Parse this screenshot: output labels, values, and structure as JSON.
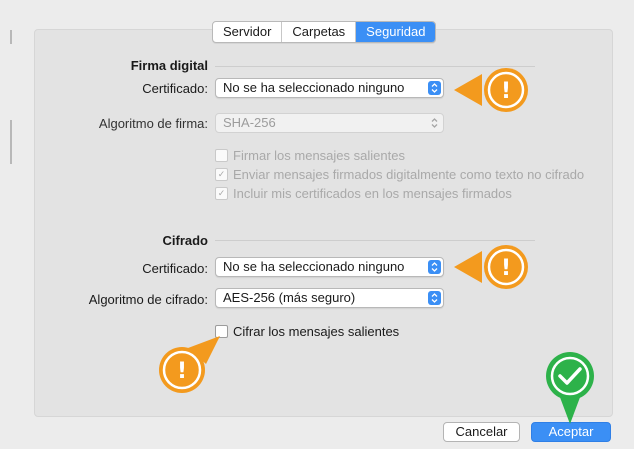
{
  "tabs": [
    {
      "label": "Servidor",
      "active": false
    },
    {
      "label": "Carpetas",
      "active": false
    },
    {
      "label": "Seguridad",
      "active": true
    }
  ],
  "firma": {
    "title": "Firma digital",
    "cert_label": "Certificado:",
    "cert_value": "No se ha seleccionado ninguno",
    "alg_label": "Algoritmo de firma:",
    "alg_value": "SHA-256",
    "checks": [
      {
        "label": "Firmar los mensajes salientes",
        "checked": false
      },
      {
        "label": "Enviar mensajes firmados digitalmente como texto no cifrado",
        "checked": true
      },
      {
        "label": "Incluir mis certificados en los mensajes firmados",
        "checked": true
      }
    ]
  },
  "cifrado": {
    "title": "Cifrado",
    "cert_label": "Certificado:",
    "cert_value": "No se ha seleccionado ninguno",
    "alg_label": "Algoritmo de cifrado:",
    "alg_value": "AES-256 (más seguro)",
    "check": {
      "label": "Cifrar los mensajes salientes",
      "checked": false
    }
  },
  "buttons": {
    "cancel": "Cancelar",
    "ok": "Aceptar"
  },
  "glyphs": {
    "warning": "!",
    "check": "✓",
    "stepper": "⌃⌄"
  },
  "colors": {
    "accent": "#3b8ff5",
    "warning": "#f39a1e",
    "success": "#2db24a"
  },
  "icons": {
    "warning_callout": "exclamation-warning-icon",
    "success_callout": "checkmark-success-icon"
  }
}
